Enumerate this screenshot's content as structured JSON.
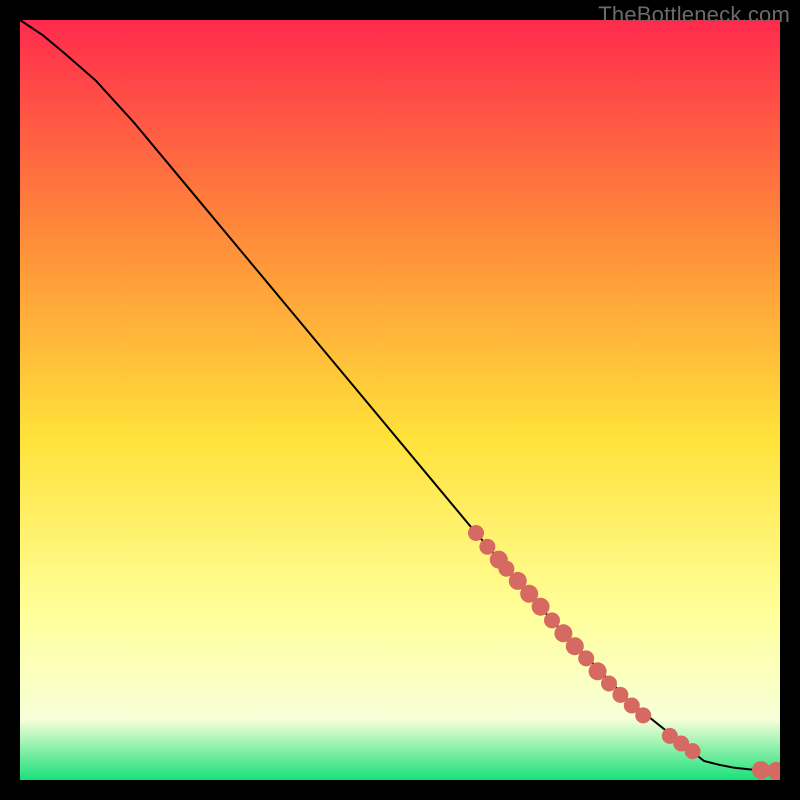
{
  "watermark": "TheBottleneck.com",
  "colors": {
    "gradient_top": "#ff2a4d",
    "gradient_mid_upper": "#ff8a3a",
    "gradient_mid": "#ffe23a",
    "gradient_lower": "#ffff9a",
    "gradient_pale": "#f7ffd8",
    "gradient_bottom": "#18e07a",
    "curve": "#000000",
    "marker": "#d66a63",
    "bg": "#000000"
  },
  "chart_data": {
    "type": "line",
    "title": "",
    "xlabel": "",
    "ylabel": "",
    "xlim": [
      0,
      100
    ],
    "ylim": [
      0,
      100
    ],
    "curve": {
      "x": [
        0,
        3,
        6,
        10,
        15,
        20,
        30,
        40,
        50,
        60,
        70,
        80,
        90,
        92,
        94,
        96,
        98,
        100
      ],
      "y": [
        100,
        98,
        95.5,
        92,
        86.5,
        80.5,
        68.5,
        56.5,
        44.5,
        32.5,
        21,
        10.5,
        2.5,
        2,
        1.6,
        1.4,
        1.3,
        1.2
      ]
    },
    "markers": {
      "x": [
        60,
        61.5,
        63,
        64,
        65.5,
        67,
        68.5,
        70,
        71.5,
        73,
        74.5,
        76,
        77.5,
        79,
        80.5,
        82,
        85.5,
        87,
        88.5,
        97.5,
        99.5
      ],
      "y": [
        32.5,
        30.7,
        29,
        27.8,
        26.2,
        24.5,
        22.8,
        21,
        19.3,
        17.6,
        16,
        14.3,
        12.7,
        11.2,
        9.8,
        8.5,
        5.8,
        4.8,
        3.8,
        1.3,
        1.2
      ],
      "r": [
        8,
        8,
        9,
        8,
        9,
        9,
        9,
        8,
        9,
        9,
        8,
        9,
        8,
        8,
        8,
        8,
        8,
        8,
        8,
        9,
        9
      ]
    }
  }
}
